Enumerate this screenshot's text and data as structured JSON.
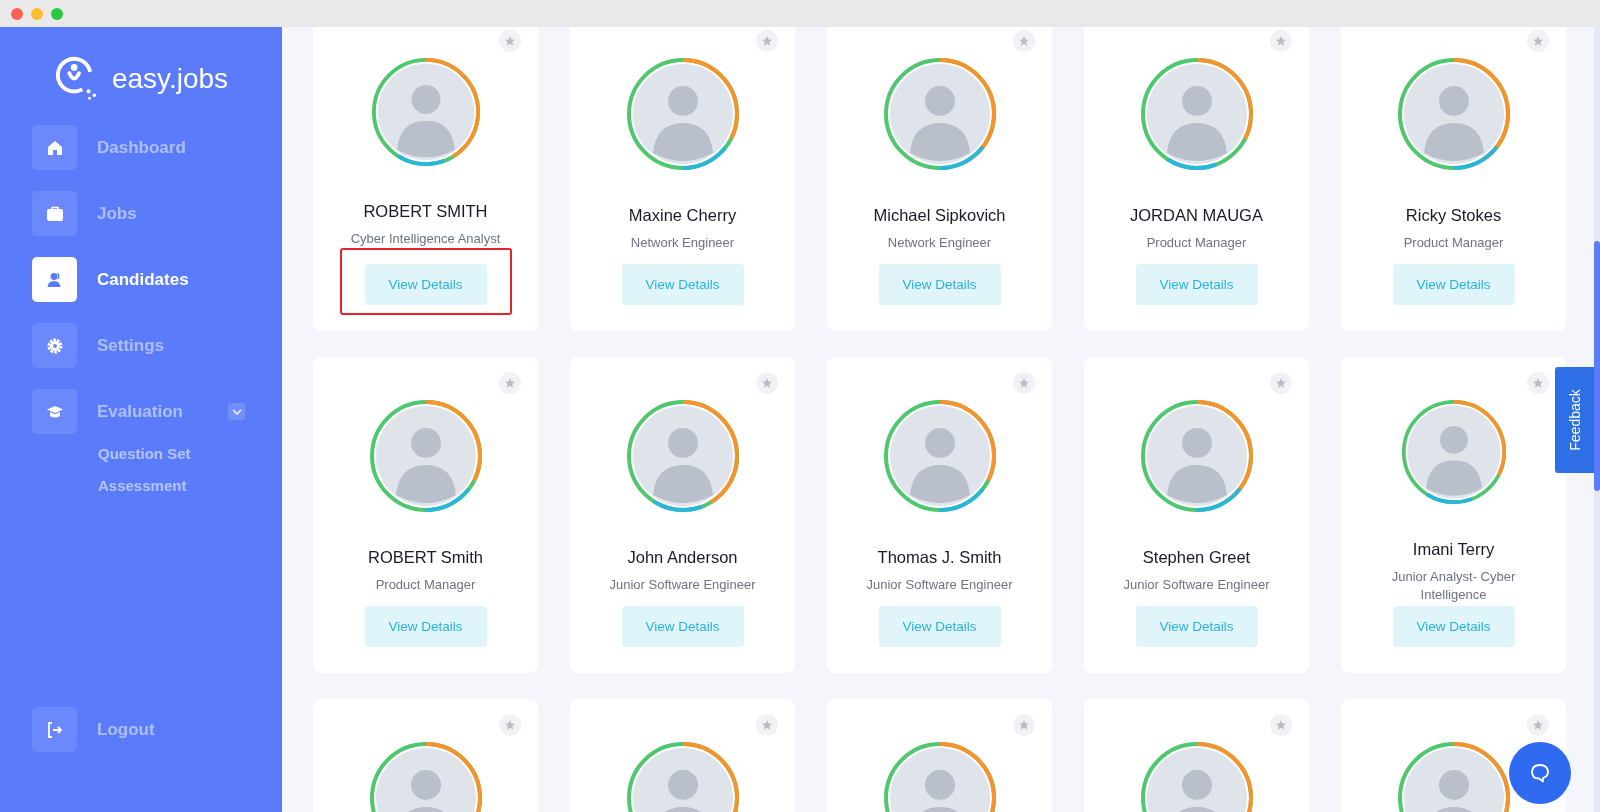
{
  "logo": {
    "text": "easy.jobs"
  },
  "sidebar": {
    "items": [
      {
        "label": "Dashboard",
        "selected": false
      },
      {
        "label": "Jobs",
        "selected": false
      },
      {
        "label": "Candidates",
        "selected": true
      },
      {
        "label": "Settings",
        "selected": false
      },
      {
        "label": "Evaluation",
        "selected": false,
        "expanded": true,
        "children": [
          {
            "label": "Question Set"
          },
          {
            "label": "Assessment"
          }
        ]
      }
    ],
    "logout": {
      "label": "Logout"
    }
  },
  "candidates": [
    {
      "name": "ROBERT SMITH",
      "title": "Cyber Intelligence Analyst",
      "button": "View Details",
      "starred": false,
      "highlighted": true
    },
    {
      "name": "Maxine Cherry",
      "title": "Network Engineer",
      "button": "View Details",
      "starred": false,
      "highlighted": false
    },
    {
      "name": "Michael Sipkovich",
      "title": "Network Engineer",
      "button": "View Details",
      "starred": false,
      "highlighted": false
    },
    {
      "name": "JORDAN MAUGA",
      "title": "Product Manager",
      "button": "View Details",
      "starred": false,
      "highlighted": false
    },
    {
      "name": "Ricky Stokes",
      "title": "Product Manager",
      "button": "View Details",
      "starred": false,
      "highlighted": false
    },
    {
      "name": "ROBERT Smith",
      "title": "Product Manager",
      "button": "View Details",
      "starred": false,
      "highlighted": false
    },
    {
      "name": "John Anderson",
      "title": "Junior Software Engineer",
      "button": "View Details",
      "starred": false,
      "highlighted": false
    },
    {
      "name": "Thomas J. Smith",
      "title": "Junior Software Engineer",
      "button": "View Details",
      "starred": false,
      "highlighted": false
    },
    {
      "name": "Stephen Greet",
      "title": "Junior Software Engineer",
      "button": "View Details",
      "starred": false,
      "highlighted": false
    },
    {
      "name": "Imani Terry",
      "title": "Junior Analyst- Cyber Intelligence",
      "button": "View Details",
      "starred": false,
      "highlighted": false
    },
    {
      "starred": false
    },
    {
      "starred": false
    },
    {
      "starred": false
    },
    {
      "starred": false
    },
    {
      "starred": false
    }
  ],
  "feedback_tab": {
    "label": "Feedback"
  }
}
